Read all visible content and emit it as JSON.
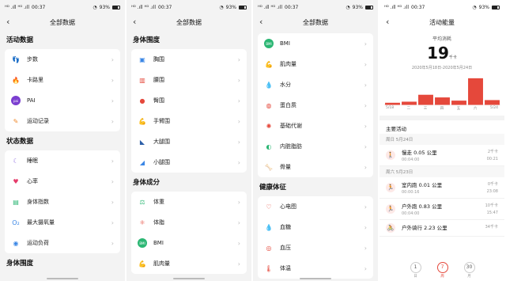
{
  "status": {
    "carrier": "ᴴᴰ .ıll ᴴᴰ .ıll",
    "time": "00:37",
    "battery": "93%"
  },
  "p1": {
    "title": "全部数据",
    "sections": [
      {
        "header": "活动数据",
        "items": [
          {
            "label": "步数",
            "icon": "footsteps-icon",
            "color": "#f08a2e",
            "glyph": "👣"
          },
          {
            "label": "卡路里",
            "icon": "flame-icon",
            "color": "#e5483b",
            "glyph": "🔥"
          },
          {
            "label": "PAI",
            "icon": "pai-icon",
            "color": "#7b3fd0",
            "glyph": "pai"
          },
          {
            "label": "运动记录",
            "icon": "record-icon",
            "color": "#f08a2e",
            "glyph": "✎"
          }
        ]
      },
      {
        "header": "状态数据",
        "items": [
          {
            "label": "睡眠",
            "icon": "moon-icon",
            "color": "#8d6ae0",
            "glyph": "☾"
          },
          {
            "label": "心率",
            "icon": "heart-icon",
            "color": "#e53b6a",
            "glyph": "♥"
          },
          {
            "label": "身体指数",
            "icon": "body-index-icon",
            "color": "#2bb673",
            "glyph": "▤"
          },
          {
            "label": "最大摄氧量",
            "icon": "vo2-icon",
            "color": "#3a86e5",
            "glyph": "O₂"
          },
          {
            "label": "运动负荷",
            "icon": "load-icon",
            "color": "#3a86e5",
            "glyph": "◉"
          }
        ]
      },
      {
        "header": "身体围度",
        "items": []
      }
    ]
  },
  "p2": {
    "title": "全部数据",
    "sections": [
      {
        "header": "身体围度",
        "items": [
          {
            "label": "胸围",
            "icon": "chest-icon",
            "color": "#3a86e5",
            "glyph": "▣"
          },
          {
            "label": "腰围",
            "icon": "waist-icon",
            "color": "#e5483b",
            "glyph": "▥"
          },
          {
            "label": "臀围",
            "icon": "hip-icon",
            "color": "#e5483b",
            "glyph": "●"
          },
          {
            "label": "手臂围",
            "icon": "arm-icon",
            "color": "#f08a2e",
            "glyph": "💪"
          },
          {
            "label": "大腿围",
            "icon": "thigh-icon",
            "color": "#2c5fa8",
            "glyph": "◣"
          },
          {
            "label": "小腿围",
            "icon": "calf-icon",
            "color": "#3a86e5",
            "glyph": "◢"
          }
        ]
      },
      {
        "header": "身体成分",
        "items": [
          {
            "label": "体重",
            "icon": "weight-icon",
            "color": "#2bb673",
            "glyph": "⚖"
          },
          {
            "label": "体脂",
            "icon": "fat-icon",
            "color": "#e5483b",
            "glyph": "⚛"
          },
          {
            "label": "BMI",
            "icon": "bmi-icon",
            "color": "#2bb673",
            "glyph": "BMI"
          },
          {
            "label": "肌肉量",
            "icon": "muscle-icon",
            "color": "#f08a2e",
            "glyph": "💪"
          }
        ]
      }
    ]
  },
  "p3": {
    "title": "全部数据",
    "sections": [
      {
        "header": "",
        "items": [
          {
            "label": "BMI",
            "icon": "bmi-icon",
            "color": "#2bb673",
            "glyph": "BMI"
          },
          {
            "label": "肌肉量",
            "icon": "muscle-icon",
            "color": "#f08a2e",
            "glyph": "💪"
          },
          {
            "label": "水分",
            "icon": "water-icon",
            "color": "#3a86e5",
            "glyph": "💧"
          },
          {
            "label": "蛋白质",
            "icon": "protein-icon",
            "color": "#e5483b",
            "glyph": "◍"
          },
          {
            "label": "基础代谢",
            "icon": "metabolism-icon",
            "color": "#e5483b",
            "glyph": "✺"
          },
          {
            "label": "内脏脂肪",
            "icon": "visceral-icon",
            "color": "#2bb673",
            "glyph": "◐"
          },
          {
            "label": "骨量",
            "icon": "bone-icon",
            "color": "#3a86e5",
            "glyph": "🦴"
          }
        ]
      },
      {
        "header": "健康体征",
        "items": [
          {
            "label": "心电图",
            "icon": "ecg-icon",
            "color": "#e5483b",
            "glyph": "♡"
          },
          {
            "label": "血糖",
            "icon": "glucose-icon",
            "color": "#e5483b",
            "glyph": "💧"
          },
          {
            "label": "血压",
            "icon": "blood-pressure-icon",
            "color": "#e5483b",
            "glyph": "◎"
          },
          {
            "label": "体温",
            "icon": "thermometer-icon",
            "color": "#e5483b",
            "glyph": "🌡"
          }
        ]
      }
    ]
  },
  "p4": {
    "title": "活动能量",
    "avg_label": "平均消耗",
    "avg_value": "19",
    "avg_unit": "千卡",
    "range": "2020年5月18日-2020年5月24日",
    "chart_data": {
      "type": "bar",
      "categories": [
        "5/18",
        "二",
        "三",
        "四",
        "五",
        "六",
        "5/24"
      ],
      "values": [
        4,
        6,
        19,
        14,
        8,
        50,
        9
      ],
      "ylim": [
        0,
        55
      ],
      "color": "#e5483b"
    },
    "activities_header": "主要活动",
    "groups": [
      {
        "date": "周日 5月24日",
        "items": [
          {
            "title": "慢走 0.05 公里",
            "duration": "00:04:00",
            "r1": "2千卡",
            "r2": "00:21",
            "icon": "walk-icon",
            "glyph": "🚶"
          }
        ]
      },
      {
        "date": "周六 5月23日",
        "items": [
          {
            "title": "室内跑 0.01 公里",
            "duration": "00:00:16",
            "r1": "0千卡",
            "r2": "23:08",
            "icon": "treadmill-icon",
            "glyph": "🏃"
          },
          {
            "title": "户外跑 0.83 公里",
            "duration": "00:04:00",
            "r1": "10千卡",
            "r2": "15:47",
            "icon": "run-icon",
            "glyph": "🏃"
          },
          {
            "title": "户外骑行 2.23 公里",
            "duration": "",
            "r1": "34千卡",
            "r2": "",
            "icon": "bike-icon",
            "glyph": "🚴"
          }
        ]
      }
    ],
    "tabs": [
      {
        "num": "1",
        "label": "日"
      },
      {
        "num": "7",
        "label": "周"
      },
      {
        "num": "30",
        "label": "月"
      }
    ],
    "active_tab": 1
  }
}
